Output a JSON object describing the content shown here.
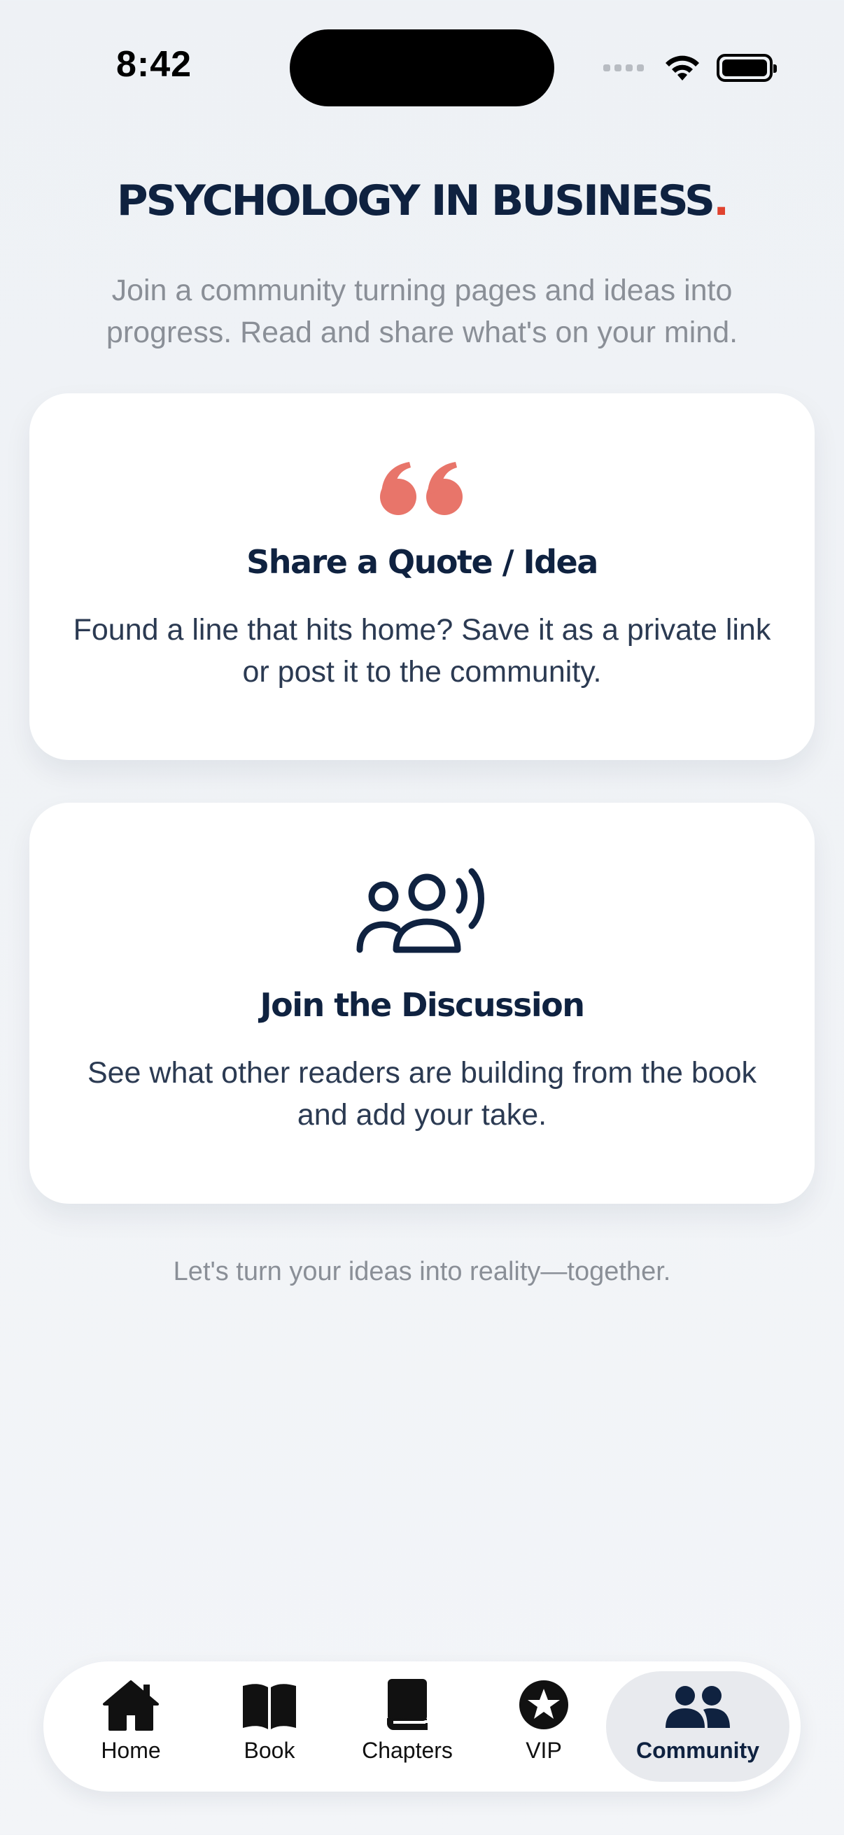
{
  "status_bar": {
    "time": "8:42"
  },
  "header": {
    "brand": "PSYCHOLOGY IN BUSINESS",
    "brand_dot": ".",
    "intro": "Join a community turning pages and ideas into progress. Read and share what's on your mind."
  },
  "cards": [
    {
      "icon": "quote-icon",
      "title": "Share a Quote / Idea",
      "description": "Found a line that hits home? Save it as a private link or post it to the community."
    },
    {
      "icon": "discussion-group-icon",
      "title": "Join the Discussion",
      "description": "See what other readers are building from the book and add your take."
    }
  ],
  "tagline": "Let's turn your ideas into reality—together.",
  "tabbar": {
    "tabs": [
      {
        "label": "Home",
        "icon": "house-icon"
      },
      {
        "label": "Book",
        "icon": "open-book-icon"
      },
      {
        "label": "Chapters",
        "icon": "closed-book-icon"
      },
      {
        "label": "VIP",
        "icon": "star-circle-icon"
      },
      {
        "label": "Community",
        "icon": "people-icon"
      }
    ],
    "active": "Community"
  },
  "colors": {
    "navy": "#0f2240",
    "accent_red": "#e0432f",
    "quote_coral": "#e8756a",
    "muted_text": "#8a8f97"
  }
}
